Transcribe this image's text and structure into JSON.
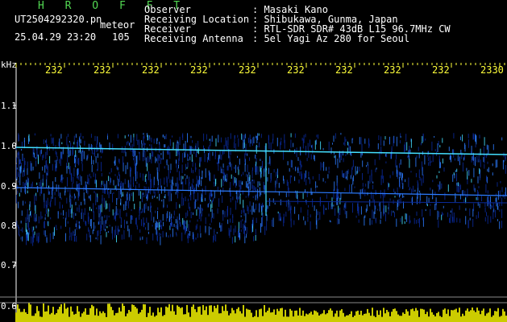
{
  "header": {
    "app_title": "H R O F F T",
    "filename": "UT2504292320.pn",
    "mode": "meteor",
    "datetime": "25.04.29 23:20",
    "count": "105",
    "fields": [
      {
        "label": "Observer",
        "value": ": Masaki Kano"
      },
      {
        "label": "Receiving Location",
        "value": ": Shibukawa, Gunma, Japan"
      },
      {
        "label": "Receiver",
        "value": ": RTL-SDR SDR# 43dB L15 96.7MHz CW"
      },
      {
        "label": "Receiving Antenna",
        "value": ": 5el Yagi Az 280 for Seoul"
      }
    ]
  },
  "axes": {
    "y_unit": "kHz",
    "y_ticks": [
      "1.1",
      "1.0",
      "0.9",
      "0.8",
      "0.7",
      "0.6"
    ],
    "x_ticks": [
      "232",
      "232",
      "232",
      "232",
      "232",
      "232",
      "232",
      "232",
      "232",
      "2330"
    ]
  },
  "colors": {
    "background": "#000000",
    "text": "#ffffff",
    "title": "#52d852",
    "ticks": "#ffff3a",
    "signal_low": "#0a2a9a",
    "signal_mid": "#2c7cff",
    "signal_high": "#44e0ff",
    "noise_bar": "#ffff00"
  }
}
